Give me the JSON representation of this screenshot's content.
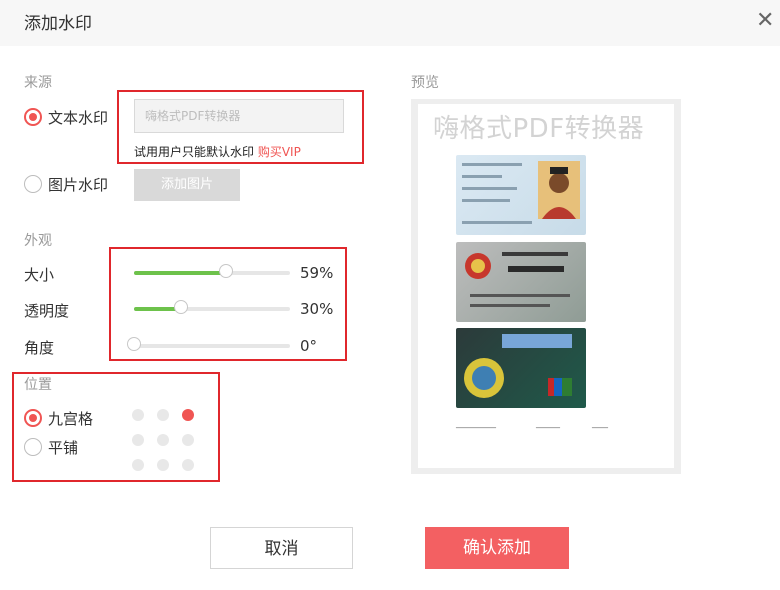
{
  "dialog": {
    "title": "添加水印",
    "close_icon": "close-icon"
  },
  "source": {
    "label": "来源",
    "text_option": "文本水印",
    "text_selected": true,
    "text_placeholder": "嗨格式PDF转换器",
    "hint": "试用用户只能默认水印",
    "hint_link": "购买VIP",
    "image_option": "图片水印",
    "image_selected": false,
    "add_image_button": "添加图片"
  },
  "appearance": {
    "label": "外观",
    "size": {
      "label": "大小",
      "value": "59%",
      "level": 0.59
    },
    "opacity": {
      "label": "透明度",
      "value": "30%",
      "level": 0.3
    },
    "angle": {
      "label": "角度",
      "value": "0°",
      "level": 0.0
    }
  },
  "position": {
    "label": "位置",
    "grid_option": "九宫格",
    "grid_selected": true,
    "tile_option": "平铺",
    "tile_selected": false,
    "grid_active_cell": "top-right"
  },
  "preview": {
    "label": "预览",
    "watermark_text": "嗨格式PDF转换器"
  },
  "buttons": {
    "cancel": "取消",
    "confirm": "确认添加"
  },
  "colors": {
    "accent": "#f05553",
    "slider_fill": "#6dc24b",
    "confirm_bg": "#f36062",
    "highlight_box": "#e0272c"
  }
}
